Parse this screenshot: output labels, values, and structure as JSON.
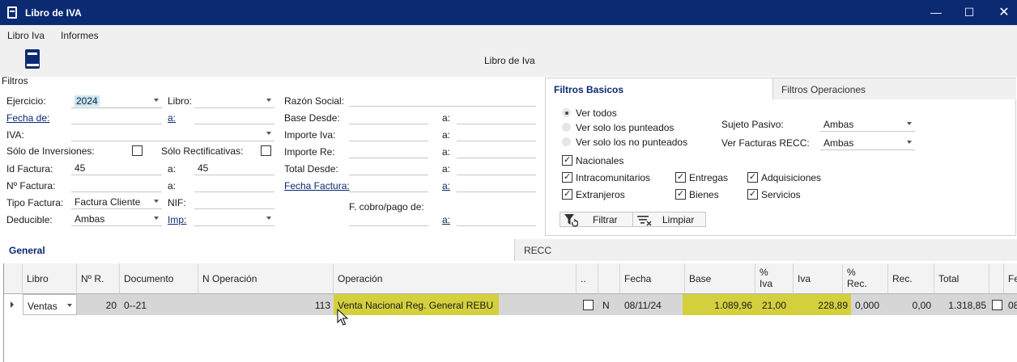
{
  "window": {
    "title": "Libro de IVA"
  },
  "menu": {
    "items": [
      "Libro Iva",
      "Informes"
    ]
  },
  "toolbar": {
    "center_title": "Libro de Iva",
    "filtros_label": "Filtros"
  },
  "filters": {
    "ejercicio_label": "Ejercicio:",
    "ejercicio_value": "2024",
    "libro_label": "Libro:",
    "libro_value": "",
    "razon_label": "Razón Social:",
    "fecha_de_label": "Fecha de:",
    "a_label": "a:",
    "base_desde_label": "Base Desde:",
    "iva_label": "IVA:",
    "importe_iva_label": "Importe Iva:",
    "solo_inversiones_label": "Sólo de Inversiones:",
    "solo_rectificativas_label": "Sólo Rectificativas:",
    "importe_re_label": "Importe Re:",
    "id_factura_label": "Id Factura:",
    "id_factura_from": "45",
    "id_factura_to": "45",
    "total_desde_label": "Total Desde:",
    "n_factura_label": "Nº Factura:",
    "fecha_factura_label": "Fecha Factura:",
    "tipo_factura_label": "Tipo Factura:",
    "tipo_factura_value": "Factura Cliente",
    "nif_label": "NIF:",
    "f_cobro_label": "F. cobro/pago de:",
    "deducible_label": "Deducible:",
    "deducible_value": "Ambas",
    "imp_label": "Imp:"
  },
  "panel": {
    "tabs": [
      "Filtros Basicos",
      "Filtros Operaciones"
    ],
    "radios": [
      "Ver todos",
      "Ver solo los punteados",
      "Ver solo los no punteados"
    ],
    "sujeto_pasivo_label": "Sujeto Pasivo:",
    "sujeto_pasivo_value": "Ambas",
    "recc_label": "Ver Facturas RECC:",
    "recc_value": "Ambas",
    "checks": {
      "nacionales": "Nacionales",
      "intracomunitarios": "Intracomunitarios",
      "entregas": "Entregas",
      "adquisiciones": "Adquisiciones",
      "extranjeros": "Extranjeros",
      "bienes": "Bienes",
      "servicios": "Servicios"
    },
    "filtrar_label": "Filtrar",
    "limpiar_label": "Limpiar"
  },
  "grid_tabs": [
    "General",
    "RECC"
  ],
  "grid": {
    "headers": {
      "libro": "Libro",
      "nr": "Nº R.",
      "documento": "Documento",
      "n_operacion": "N Operación",
      "operacion": "Operación",
      "dots": "..",
      "fecha": "Fecha",
      "base": "Base",
      "pct_iva": "%\nIva",
      "iva": "Iva",
      "pct_rec": "%\nRec.",
      "rec": "Rec.",
      "total": "Total",
      "fe": "Fe"
    },
    "row": {
      "libro": "Ventas",
      "nr": "20",
      "documento": "0--21",
      "n_operacion": "113",
      "operacion": "Venta Nacional Reg. General REBU",
      "n": "N",
      "fecha": "08/11/24",
      "base": "1.089,96",
      "pct_iva": "21,00",
      "iva": "228,89",
      "pct_rec": "0,000",
      "rec": "0,00",
      "total": "1.318,85",
      "fe": "08"
    }
  },
  "colors": {
    "titlebar": "#0b2a72",
    "highlight": "#d4d03d",
    "selection": "#c8e8f8"
  }
}
